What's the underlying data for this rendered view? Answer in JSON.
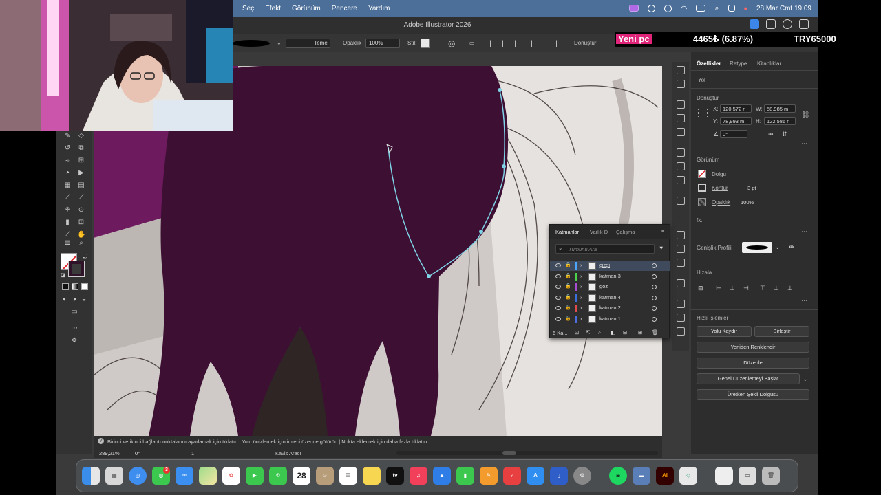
{
  "menubar": {
    "menus": [
      "Seç",
      "Efekt",
      "Görünüm",
      "Pencere",
      "Yardım"
    ],
    "datetime": "28 Mar Cmt  19:09"
  },
  "window": {
    "title": "Adobe Illustrator 2026"
  },
  "controlbar": {
    "stroke_profile": "Temel",
    "opacity_label": "Opaklık",
    "opacity_value": "100%",
    "style_label": "Stil:",
    "transform_label": "Dönüştür"
  },
  "ticker": {
    "label": "Yeni pc",
    "change": "4465₺ (6.87%)",
    "target": "TRY65000"
  },
  "props": {
    "tabs": [
      "Özellikler",
      "Katmanlar",
      "Kitaplıklar"
    ],
    "tab_labels": [
      "Özellikler",
      "Retype",
      "Kitaplıklar"
    ],
    "object_type": "Yol",
    "transform_heading": "Dönüştür",
    "x_label": "X:",
    "x_value": "120,572 r",
    "y_label": "Y:",
    "y_value": "78,993 m",
    "w_label": "W:",
    "w_value": "58,985 m",
    "h_label": "H:",
    "h_value": "122,586 r",
    "angle_value": "0°",
    "appearance_heading": "Görünüm",
    "fill_label": "Dolgu",
    "stroke_label": "Kontur",
    "stroke_value": "3 pt",
    "opacity_label": "Opaklık",
    "opacity_value": "100%",
    "fx_label": "fx.",
    "width_profile_label": "Genişlik Profili",
    "align_heading": "Hizala",
    "quick_actions_heading": "Hızlı İşlemler",
    "btn_offset_path": "Yolu Kaydır",
    "btn_unite": "Birleştir",
    "btn_recolor": "Yeniden Renklendir",
    "btn_arrange": "Düzenle",
    "btn_global_edit": "Genel Düzenlemeyi Başlat",
    "btn_generative_fill": "Üretken Şekil Dolgusu"
  },
  "layers": {
    "tabs": [
      "Katmanlar",
      "Varlık D",
      "Çalışma"
    ],
    "search_placeholder": "Tümünü Ara",
    "items": [
      {
        "name": "çizgi",
        "color": "#4ca6ff"
      },
      {
        "name": "katman 3",
        "color": "#4cd34c"
      },
      {
        "name": "göz",
        "color": "#a64cd3"
      },
      {
        "name": "katman 4",
        "color": "#3a6fe0"
      },
      {
        "name": "katman 2",
        "color": "#e04c4c"
      },
      {
        "name": "katman 1",
        "color": "#4c6fe0"
      }
    ],
    "count_label": "6 Ka..."
  },
  "statusbar": {
    "hint": "Birinci ve ikinci bağlantı noktalarını ayarlamak için tıklatın  |  Yolu önizlemek için imleci üzerine götürün  |  Nokta eklemek için daha fazla tıklatın",
    "zoom": "289,21%",
    "rotation": "0°",
    "artboard": "1",
    "tool_name": "Kavis Aracı"
  },
  "dock": {
    "calendar_day": "28",
    "messages_badge": "3",
    "ai_label": "Ai",
    "tv_label": "tv"
  },
  "colors": {
    "hair": "#3d0f33",
    "selection": "#7fd3e6",
    "menubar": "#4c6f9a"
  }
}
